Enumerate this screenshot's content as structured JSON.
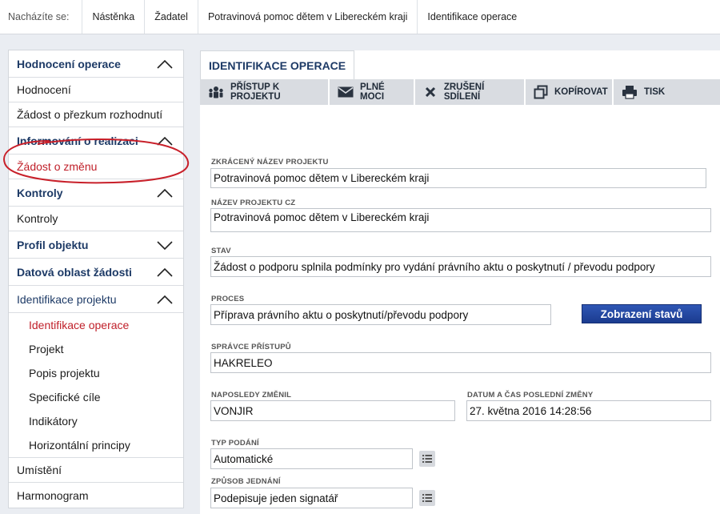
{
  "breadcrumb": {
    "prefix": "Nacházíte se:",
    "items": [
      "Nástěnka",
      "Žadatel",
      "Potravinová pomoc dětem v Libereckém kraji",
      "Identifikace operace"
    ]
  },
  "sidebar": {
    "sections": [
      {
        "title": "Hodnocení operace",
        "items": [
          "Hodnocení",
          "Žádost o přezkum rozhodnutí"
        ]
      },
      {
        "title": "Informování o realizaci",
        "items": [
          "Žádost o změnu"
        ]
      },
      {
        "title": "Kontroly",
        "items": [
          "Kontroly"
        ]
      },
      {
        "title": "Profil objektu"
      },
      {
        "title": "Datová oblast žádosti"
      },
      {
        "title": "Identifikace projektu",
        "items": [
          "Identifikace operace",
          "Projekt",
          "Popis projektu",
          "Specifické cíle",
          "Indikátory",
          "Horizontální principy"
        ]
      },
      {
        "items": [
          "Umístění",
          "Harmonogram"
        ]
      }
    ]
  },
  "main": {
    "tab_title": "IDENTIFIKACE OPERACE",
    "toolbar": [
      "PŘÍSTUP K PROJEKTU",
      "PLNÉ MOCI",
      "ZRUŠENÍ SDÍLENÍ",
      "KOPÍROVAT",
      "TISK"
    ],
    "fields": {
      "short_name_label": "ZKRÁCENÝ NÁZEV PROJEKTU",
      "short_name": "Potravinová pomoc dětem v Libereckém kraji",
      "name_cz_label": "NÁZEV PROJEKTU CZ",
      "name_cz": "Potravinová pomoc dětem v Libereckém kraji",
      "state_label": "STAV",
      "state": "Žádost o podporu splnila podmínky pro vydání právního aktu o poskytnutí / převodu podpory",
      "process_label": "PROCES",
      "process": "Příprava právního aktu o poskytnutí/převodu podpory",
      "show_states_button": "Zobrazení stavů",
      "access_admin_label": "SPRÁVCE PŘÍSTUPŮ",
      "access_admin": "HAKRELEO",
      "last_changed_by_label": "NAPOSLEDY ZMĚNIL",
      "last_changed_by": "VONJIR",
      "last_change_label": "DATUM A ČAS POSLEDNÍ ZMĚNY",
      "last_change": "27. května 2016 14:28:56",
      "submission_type_label": "TYP PODÁNÍ",
      "submission_type": "Automatické",
      "conduct_label": "ZPŮSOB JEDNÁNÍ",
      "conduct": "Podepisuje jeden signatář"
    }
  },
  "colors": {
    "accent": "#1d3a66",
    "active": "#c0202a",
    "button": "#2147a3",
    "annotation": "#c8202a"
  }
}
